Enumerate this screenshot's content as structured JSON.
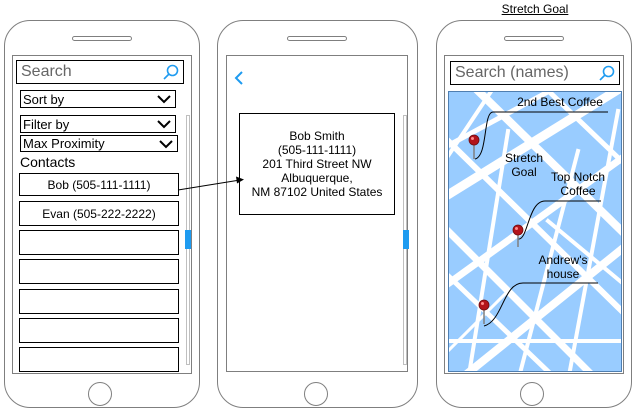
{
  "stretch_goal_title": "Stretch Goal",
  "list_screen": {
    "search_placeholder": "Search",
    "sort_label": "Sort by",
    "filter_label": "Filter by",
    "proximity_label": "Max Proximity",
    "contacts_heading": "Contacts",
    "contacts": [
      "Bob (505-111-1111)",
      "Evan (505-222-2222)"
    ]
  },
  "detail_screen": {
    "lines": [
      "Bob Smith",
      "(505-111-1111)",
      "201 Third Street NW",
      "Albuquerque,",
      "NM 87102 United States"
    ]
  },
  "map_screen": {
    "search_placeholder": "Search (names)",
    "annotations": {
      "second_best_coffee": "2nd Best Coffee",
      "stretch_goal_line1": "Stretch",
      "stretch_goal_line2": "Goal",
      "top_notch_line1": "Top Notch",
      "top_notch_line2": "Coffee",
      "andrews_line1": "Andrew's",
      "andrews_line2": "house"
    }
  },
  "colors": {
    "accent": "#1e9bf0",
    "map_water": "#99ccff",
    "map_road": "#ffffff",
    "map_border": "#4f7eb0",
    "pin": "#b3141b"
  }
}
